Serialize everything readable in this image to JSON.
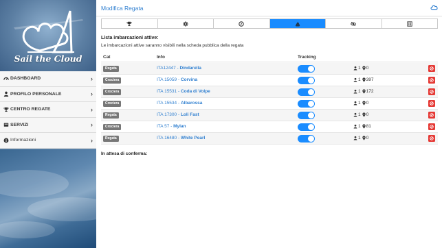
{
  "sidebar": {
    "logo_text": "Sail the Cloud",
    "menu": [
      {
        "label": "DASHBOARD",
        "icon": "tachometer-icon"
      },
      {
        "label": "PROFILO PERSONALE",
        "icon": "user-icon"
      },
      {
        "label": "CENTRO REGATE",
        "icon": "trophy-icon"
      },
      {
        "label": "SERVIZI",
        "icon": "folder-icon"
      },
      {
        "label": "Informazioni",
        "icon": "info-circle-icon"
      }
    ]
  },
  "header": {
    "title": "Modifica Regata",
    "cloud_icon": "cloud-icon"
  },
  "tabs": [
    {
      "icon": "trophy-icon",
      "active": false
    },
    {
      "icon": "gear-icon",
      "active": false
    },
    {
      "icon": "compass-icon",
      "active": false
    },
    {
      "icon": "sailboat-icon",
      "active": true
    },
    {
      "icon": "eye-slash-icon",
      "active": false
    },
    {
      "icon": "list-alt-icon",
      "active": false
    }
  ],
  "section": {
    "title": "Lista imbarcazioni attive:",
    "note": "Le imbarcazioni attive saranno visibili nella scheda pubblica della regata"
  },
  "table": {
    "columns": [
      "Cat",
      "Info",
      "Tracking"
    ],
    "rows": [
      {
        "cat": "Regata",
        "sail": "ITA12447 - ",
        "name": "Dindarella",
        "crew": "1",
        "count": "0",
        "tracking": true
      },
      {
        "cat": "Crociera",
        "sail": "ITA 15059 - ",
        "name": "Corvina",
        "crew": "1",
        "count": "397",
        "tracking": true
      },
      {
        "cat": "Crociera",
        "sail": "ITA 15531 - ",
        "name": "Coda di Volpe",
        "crew": "1",
        "count": "172",
        "tracking": true
      },
      {
        "cat": "Crociera",
        "sail": "ITA 15534 - ",
        "name": "Albarossa",
        "crew": "1",
        "count": "0",
        "tracking": true
      },
      {
        "cat": "Regata",
        "sail": "ITA 17300 - ",
        "name": "Loli Fast",
        "crew": "1",
        "count": "0",
        "tracking": true
      },
      {
        "cat": "Crociera",
        "sail": "ITA 57 - ",
        "name": "Mylan",
        "crew": "1",
        "count": "81",
        "tracking": true
      },
      {
        "cat": "Regata",
        "sail": "ITA 16480 - ",
        "name": "White Pearl",
        "crew": "1",
        "count": "0",
        "tracking": true
      }
    ]
  },
  "pending": {
    "title": "In attesa di conferma:"
  },
  "colors": {
    "accent": "#1a8cff",
    "link": "#2f7fd0",
    "danger": "#e53935",
    "badge": "#777777"
  }
}
